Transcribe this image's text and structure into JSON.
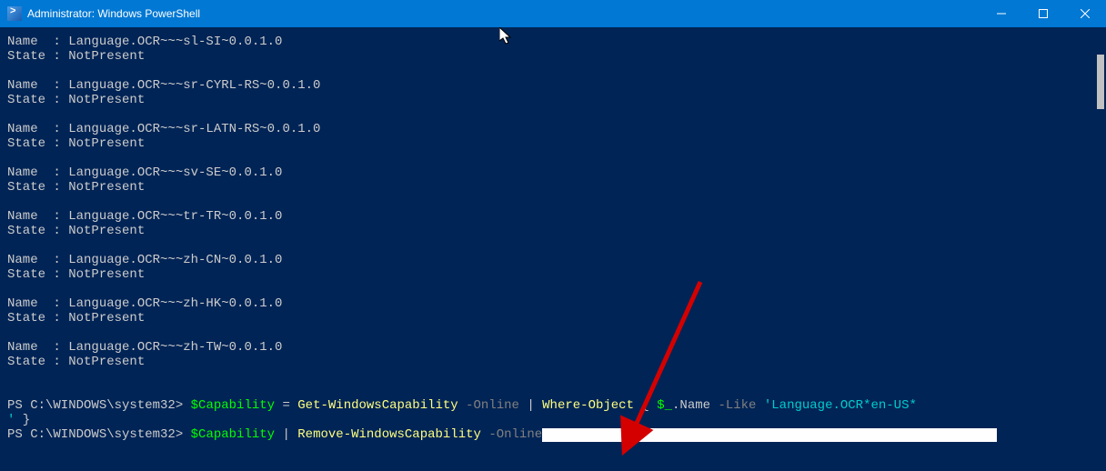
{
  "titlebar": {
    "title": "Administrator: Windows PowerShell"
  },
  "entries": [
    {
      "name": "Language.OCR~~~sl-SI~0.0.1.0",
      "state": "NotPresent"
    },
    {
      "name": "Language.OCR~~~sr-CYRL-RS~0.0.1.0",
      "state": "NotPresent"
    },
    {
      "name": "Language.OCR~~~sr-LATN-RS~0.0.1.0",
      "state": "NotPresent"
    },
    {
      "name": "Language.OCR~~~sv-SE~0.0.1.0",
      "state": "NotPresent"
    },
    {
      "name": "Language.OCR~~~tr-TR~0.0.1.0",
      "state": "NotPresent"
    },
    {
      "name": "Language.OCR~~~zh-CN~0.0.1.0",
      "state": "NotPresent"
    },
    {
      "name": "Language.OCR~~~zh-HK~0.0.1.0",
      "state": "NotPresent"
    },
    {
      "name": "Language.OCR~~~zh-TW~0.0.1.0",
      "state": "NotPresent"
    }
  ],
  "labels": {
    "name_label": "Name  : ",
    "state_label": "State : "
  },
  "prompt": {
    "ps": "PS C:\\WINDOWS\\system32> ",
    "line1_var": "$Capability",
    "line1_eq": " = ",
    "line1_cmd": "Get-WindowsCapability",
    "line1_sp1": " ",
    "line1_param1": "-Online",
    "line1_sp2": " ",
    "line1_pipe": "|",
    "line1_sp3": " ",
    "line1_cmd2": "Where-Object",
    "line1_sp4": " { ",
    "line1_var2": "$_",
    "line1_dotname": ".Name ",
    "line1_like": "-Like",
    "line1_sp5": " ",
    "line1_str": "'Language.OCR*en-US*\n'",
    "line1_close": " }",
    "line2_var": "$Capability",
    "line2_sp1": " ",
    "line2_pipe": "|",
    "line2_sp2": " ",
    "line2_cmd": "Remove-WindowsCapability",
    "line2_sp3": " ",
    "line2_param": "-Online"
  }
}
